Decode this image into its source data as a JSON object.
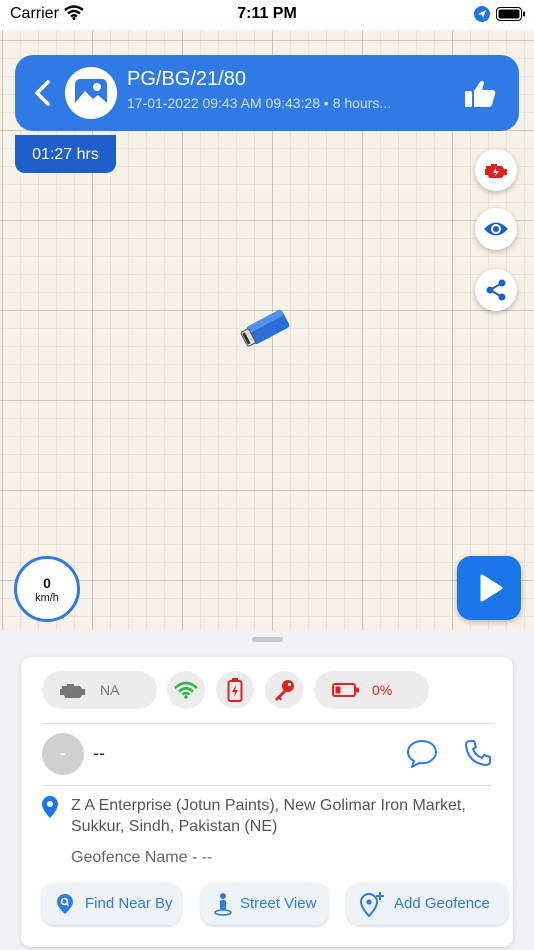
{
  "status_bar": {
    "carrier": "Carrier",
    "time": "7:11 PM"
  },
  "header": {
    "vehicle_id": "PG/BG/21/80",
    "subtitle": "17-01-2022 09:43 AM 09:43:28 • 8 hours...",
    "duration": "01:27 hrs"
  },
  "map": {
    "side_buttons": [
      "engine-icon",
      "eye-icon",
      "share-icon"
    ]
  },
  "speed": {
    "value": "0",
    "unit": "km/h"
  },
  "status": {
    "ignition": "NA",
    "battery": "0%"
  },
  "driver": {
    "initial": "-",
    "name": "--"
  },
  "location": {
    "address": "Z A Enterprise (Jotun Paints), New Golimar Iron Market, Sukkur, Sindh, Pakistan (NE)",
    "geofence": "Geofence Name - --"
  },
  "actions": {
    "find_near_by": "Find Near By",
    "street_view": "Street View",
    "add_geofence": "Add Geofence"
  },
  "colors": {
    "primary": "#2f7ae5",
    "badge": "#1f5fc9",
    "danger": "#e32020",
    "wifi": "#2fb34a"
  }
}
